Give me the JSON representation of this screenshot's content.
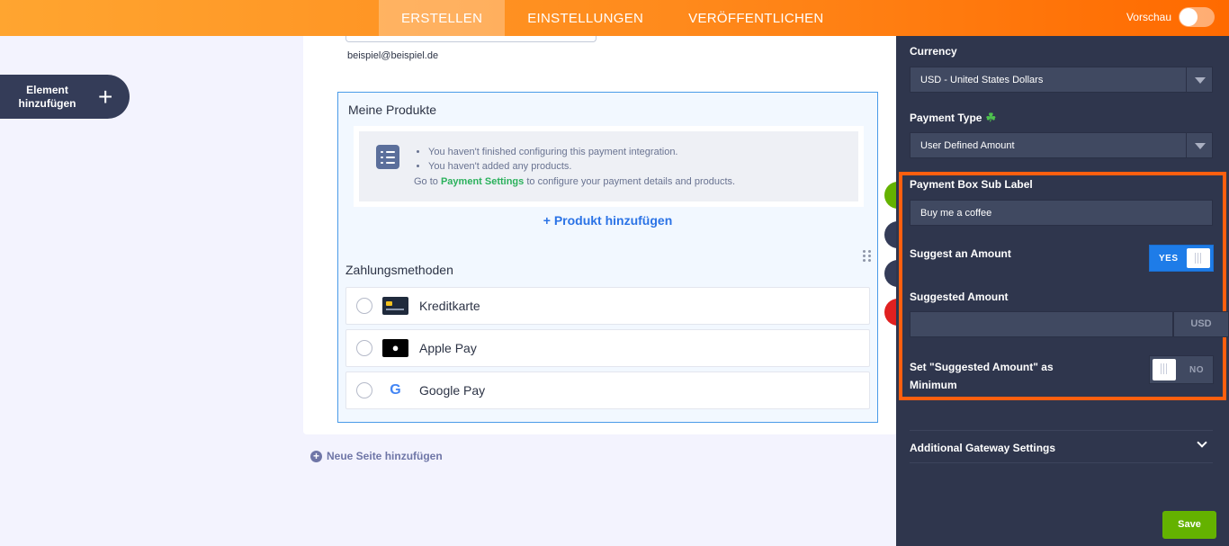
{
  "topbar": {
    "tabs": [
      "ERSTELLEN",
      "EINSTELLUNGEN",
      "VERÖFFENTLICHEN"
    ],
    "active_tab": "ERSTELLEN",
    "preview_label": "Vorschau",
    "preview_on": false
  },
  "sidebar": {
    "add_element_label": "Element\nhinzufügen",
    "add_icon": "plus-icon"
  },
  "form": {
    "email_sublabel": "beispiel@beispiel.de",
    "products_title": "Meine Produkte",
    "notice_items": [
      "You haven't finished configuring this payment integration.",
      "You haven't added any products."
    ],
    "notice_goto_prefix": "Go to",
    "notice_goto_link": "Payment Settings",
    "notice_goto_suffix": "to configure your payment details and products.",
    "add_product_label": "+ Produkt hinzufügen",
    "payment_methods_title": "Zahlungsmethoden",
    "payment_methods": [
      {
        "name": "Kreditkarte",
        "icon": "credit-card-icon"
      },
      {
        "name": "Apple Pay",
        "icon": "apple-icon"
      },
      {
        "name": "Google Pay",
        "icon": "google-icon"
      }
    ],
    "new_page_label": "Neue Seite hinzufügen"
  },
  "panel": {
    "currency_label": "Currency",
    "currency_value": "USD - United States Dollars",
    "payment_type_label": "Payment Type",
    "payment_type_value": "User Defined Amount",
    "sub_label_label": "Payment Box Sub Label",
    "sub_label_value": "Buy me a coffee",
    "suggest_amount_label": "Suggest an Amount",
    "suggest_amount_toggle": "YES",
    "suggested_amount_label": "Suggested Amount",
    "suggested_amount_value": "",
    "suggested_amount_unit": "USD",
    "set_minimum_label": "Set \"Suggested Amount\" as Minimum",
    "set_minimum_toggle": "NO",
    "gateway_label": "Additional Gateway Settings",
    "save_label": "Save"
  },
  "colors": {
    "topbar_start": "#ffa530",
    "topbar_end": "#ff6a00",
    "panel_bg": "#2f364d",
    "highlight": "#ff5f0f",
    "toggle_on": "#1e7ce8",
    "save": "#64b200",
    "link": "#2b73e6"
  }
}
